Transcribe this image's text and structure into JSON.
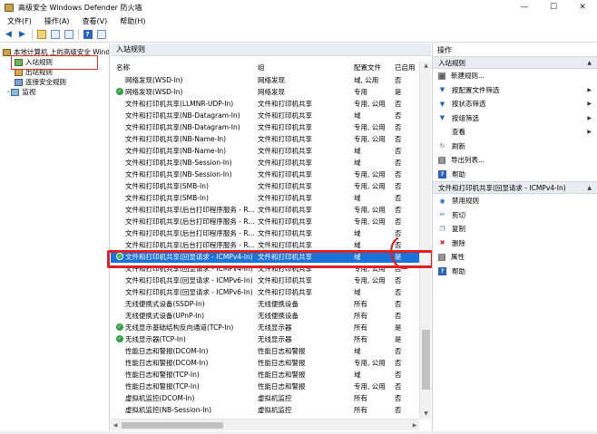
{
  "window": {
    "title": "高级安全 Windows Defender 防火墙",
    "controls": {
      "minimize": "—",
      "maximize": "☐",
      "close": "✕"
    }
  },
  "menu": [
    "文件(F)",
    "操作(A)",
    "查看(V)",
    "帮助(H)"
  ],
  "tree": {
    "root": "本地计算机 上的高级安全 Windo",
    "items": [
      "入站规则",
      "出站规则",
      "连接安全规则",
      "监视"
    ]
  },
  "center": {
    "panel_title": "入站规则",
    "columns": {
      "name": "名称",
      "group": "组",
      "profile": "配置文件",
      "enabled": "已启用"
    },
    "rows": [
      {
        "name": "网络发现(WSD-In)",
        "group": "网络发现",
        "profile": "域, 公用",
        "enabled": "否",
        "active": false
      },
      {
        "name": "网络发现(WSD-In)",
        "group": "网络发现",
        "profile": "专用",
        "enabled": "是",
        "active": true
      },
      {
        "name": "文件和打印机共享(LLMNR-UDP-In)",
        "group": "文件和打印机共享",
        "profile": "专用, 公用",
        "enabled": "否",
        "active": false
      },
      {
        "name": "文件和打印机共享(NB-Datagram-In)",
        "group": "文件和打印机共享",
        "profile": "域",
        "enabled": "否",
        "active": false
      },
      {
        "name": "文件和打印机共享(NB-Datagram-In)",
        "group": "文件和打印机共享",
        "profile": "专用, 公用",
        "enabled": "否",
        "active": false
      },
      {
        "name": "文件和打印机共享(NB-Name-In)",
        "group": "文件和打印机共享",
        "profile": "专用, 公用",
        "enabled": "否",
        "active": false
      },
      {
        "name": "文件和打印机共享(NB-Name-In)",
        "group": "文件和打印机共享",
        "profile": "域",
        "enabled": "否",
        "active": false
      },
      {
        "name": "文件和打印机共享(NB-Session-In)",
        "group": "文件和打印机共享",
        "profile": "域",
        "enabled": "否",
        "active": false
      },
      {
        "name": "文件和打印机共享(NB-Session-In)",
        "group": "文件和打印机共享",
        "profile": "专用, 公用",
        "enabled": "否",
        "active": false
      },
      {
        "name": "文件和打印机共享(SMB-In)",
        "group": "文件和打印机共享",
        "profile": "专用, 公用",
        "enabled": "否",
        "active": false
      },
      {
        "name": "文件和打印机共享(SMB-In)",
        "group": "文件和打印机共享",
        "profile": "域",
        "enabled": "否",
        "active": false
      },
      {
        "name": "文件和打印机共享(后台打印程序服务 - R...",
        "group": "文件和打印机共享",
        "profile": "专用, 公用",
        "enabled": "否",
        "active": false
      },
      {
        "name": "文件和打印机共享(后台打印程序服务 - R...",
        "group": "文件和打印机共享",
        "profile": "专用, 公用",
        "enabled": "否",
        "active": false
      },
      {
        "name": "文件和打印机共享(后台打印程序服务 - R...",
        "group": "文件和打印机共享",
        "profile": "域",
        "enabled": "否",
        "active": false
      },
      {
        "name": "文件和打印机共享(后台打印程序服务 - R...",
        "group": "文件和打印机共享",
        "profile": "域",
        "enabled": "否",
        "active": false
      },
      {
        "name": "文件和打印机共享(回显请求 - ICMPv4-In)",
        "group": "文件和打印机共享",
        "profile": "域",
        "enabled": "是",
        "active": true,
        "selected": true
      },
      {
        "name": "文件和打印机共享(回显请求 - ICMPv4-In)",
        "group": "文件和打印机共享",
        "profile": "专用, 公用",
        "enabled": "否",
        "active": false
      },
      {
        "name": "文件和打印机共享(回显请求 - ICMPv6-In)",
        "group": "文件和打印机共享",
        "profile": "专用, 公用",
        "enabled": "否",
        "active": false
      },
      {
        "name": "文件和打印机共享(回显请求 - ICMPv6-In)",
        "group": "文件和打印机共享",
        "profile": "域",
        "enabled": "否",
        "active": false
      },
      {
        "name": "无线便携式设备(SSDP-In)",
        "group": "无线便携设备",
        "profile": "所有",
        "enabled": "否",
        "active": false
      },
      {
        "name": "无线便携式设备(UPnP-In)",
        "group": "无线便携设备",
        "profile": "所有",
        "enabled": "否",
        "active": false
      },
      {
        "name": "无线显示基础结构反向通道(TCP-In)",
        "group": "无线显示器",
        "profile": "所有",
        "enabled": "是",
        "active": true
      },
      {
        "name": "无线显示器(TCP-In)",
        "group": "无线显示器",
        "profile": "所有",
        "enabled": "是",
        "active": true
      },
      {
        "name": "性能日志和警报(DCOM-In)",
        "group": "性能日志和警报",
        "profile": "域",
        "enabled": "否",
        "active": false
      },
      {
        "name": "性能日志和警报(DCOM-In)",
        "group": "性能日志和警报",
        "profile": "专用, 公用",
        "enabled": "否",
        "active": false
      },
      {
        "name": "性能日志和警报(TCP-In)",
        "group": "性能日志和警报",
        "profile": "域",
        "enabled": "否",
        "active": false
      },
      {
        "name": "性能日志和警报(TCP-In)",
        "group": "性能日志和警报",
        "profile": "专用, 公用",
        "enabled": "否",
        "active": false
      },
      {
        "name": "虚拟机监控(DCOM-In)",
        "group": "虚拟机监控",
        "profile": "所有",
        "enabled": "否",
        "active": false
      },
      {
        "name": "虚拟机监控(NB-Session-In)",
        "group": "虚拟机监控",
        "profile": "所有",
        "enabled": "否",
        "active": false
      }
    ]
  },
  "actions": {
    "title": "操作",
    "section1": "入站规则",
    "section1_items": [
      {
        "label": "新建规则...",
        "icon": "new-rule-icon",
        "glyph": "▦",
        "cls": "sq",
        "sub": false
      },
      {
        "label": "按配置文件筛选",
        "icon": "filter-icon",
        "glyph": "▼",
        "cls": "filter",
        "sub": true
      },
      {
        "label": "按状态筛选",
        "icon": "filter-icon",
        "glyph": "▼",
        "cls": "filter",
        "sub": true
      },
      {
        "label": "按组筛选",
        "icon": "filter-icon",
        "glyph": "▼",
        "cls": "filter",
        "sub": true
      },
      {
        "label": "查看",
        "icon": "view-icon",
        "glyph": "",
        "cls": "",
        "sub": true
      },
      {
        "label": "刷新",
        "icon": "refresh-icon",
        "glyph": "↻",
        "cls": "green",
        "sub": false
      },
      {
        "label": "导出列表...",
        "icon": "export-icon",
        "glyph": "▤",
        "cls": "sq",
        "sub": false
      },
      {
        "label": "帮助",
        "icon": "help-icon",
        "glyph": "?",
        "cls": "help",
        "sub": false
      }
    ],
    "section2": "文件和打印机共享(回显请求 - ICMPv4-In)",
    "section2_items": [
      {
        "label": "禁用规则",
        "icon": "disable-icon",
        "glyph": "◉",
        "cls": "blue"
      },
      {
        "label": "剪切",
        "icon": "cut-icon",
        "glyph": "✂",
        "cls": "blue"
      },
      {
        "label": "复制",
        "icon": "copy-icon",
        "glyph": "❐",
        "cls": "blue"
      },
      {
        "label": "删除",
        "icon": "delete-icon",
        "glyph": "✖",
        "cls": "red"
      },
      {
        "label": "属性",
        "icon": "properties-icon",
        "glyph": "▤",
        "cls": "sq"
      },
      {
        "label": "帮助",
        "icon": "help-icon",
        "glyph": "?",
        "cls": "help"
      }
    ]
  },
  "colors": {
    "selection": "#1a73d8",
    "annotation": "#e02020",
    "check": "#2ea043"
  }
}
